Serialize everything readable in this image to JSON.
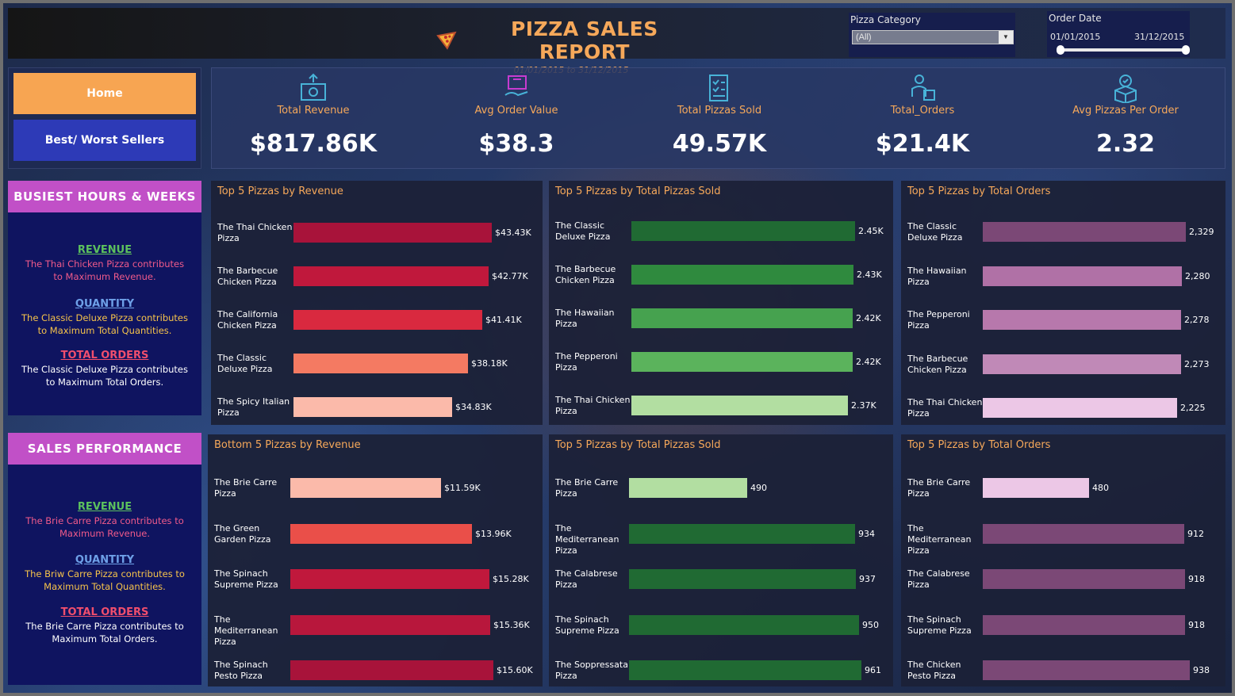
{
  "header": {
    "title": "PIZZA SALES REPORT",
    "subtitle": "01/01/2015  to 31/12/2015",
    "category_filter": {
      "label": "Pizza Category",
      "value": "(All)"
    },
    "date_filter": {
      "label": "Order Date",
      "start": "01/01/2015",
      "end": "31/12/2015"
    }
  },
  "nav": {
    "home": "Home",
    "sellers": "Best/ Worst Sellers"
  },
  "kpis": [
    {
      "label": "Total Revenue",
      "value": "$817.86K",
      "icon": "money-icon"
    },
    {
      "label": "Avg Order Value",
      "value": "$38.3",
      "icon": "delivery-box-icon"
    },
    {
      "label": "Total Pizzas Sold",
      "value": "49.57K",
      "icon": "checklist-icon"
    },
    {
      "label": "Total_Orders",
      "value": "$21.4K",
      "icon": "delivery-person-icon"
    },
    {
      "label": "Avg Pizzas Per Order",
      "value": "2.32",
      "icon": "badge-box-icon"
    }
  ],
  "busiest": {
    "title": "BUSIEST HOURS & WEEKS",
    "revenue_h": "REVENUE",
    "revenue_t": "The Thai Chicken Pizza contributes to Maximum Revenue.",
    "quantity_h": "QUANTITY",
    "quantity_t": "The Classic Deluxe Pizza contributes to Maximum Total Quantities.",
    "orders_h": "TOTAL ORDERS",
    "orders_t": "The Classic Deluxe Pizza contributes to Maximum Total Orders."
  },
  "performance": {
    "title": "SALES PERFORMANCE",
    "revenue_h": "REVENUE",
    "revenue_t": "The Brie Carre Pizza contributes to Maximum Revenue.",
    "quantity_h": "QUANTITY",
    "quantity_t": "The Briw Carre Pizza contributes to Maximum Total Quantities.",
    "orders_h": "TOTAL ORDERS",
    "orders_t": "The Brie Carre Pizza contributes to Maximum Total Orders."
  },
  "colors": {
    "accent": "#f6a85a",
    "home_btn": "#f7a552",
    "sellers_btn": "#2d3ab7",
    "panel_head": "#c150c7"
  },
  "chart_data": [
    {
      "type": "bar",
      "orientation": "horizontal",
      "title": "Top 5 Pizzas by Revenue",
      "categories": [
        "The Thai Chicken Pizza",
        "The Barbecue Chicken Pizza",
        "The California Chicken Pizza",
        "The Classic Deluxe Pizza",
        "The Spicy Italian Pizza"
      ],
      "values": [
        43430,
        42770,
        41410,
        38180,
        34830
      ],
      "labels": [
        "$43.43K",
        "$42.77K",
        "$41.41K",
        "$38.18K",
        "$34.83K"
      ],
      "colors": [
        "#a8133a",
        "#c0183c",
        "#d9293f",
        "#f47a62",
        "#fbbaaa"
      ]
    },
    {
      "type": "bar",
      "orientation": "horizontal",
      "title": "Top 5 Pizzas by Total Pizzas Sold",
      "categories": [
        "The Classic Deluxe Pizza",
        "The Barbecue Chicken Pizza",
        "The Hawaiian Pizza",
        "The Pepperoni Pizza",
        "The Thai Chicken Pizza"
      ],
      "values": [
        2450,
        2430,
        2420,
        2420,
        2370
      ],
      "labels": [
        "2.45K",
        "2.43K",
        "2.42K",
        "2.42K",
        "2.37K"
      ],
      "colors": [
        "#206a33",
        "#2f8a3e",
        "#46a24f",
        "#5bb35c",
        "#b2dea1"
      ]
    },
    {
      "type": "bar",
      "orientation": "horizontal",
      "title": "Top 5 Pizzas by Total Orders",
      "categories": [
        "The Classic Deluxe Pizza",
        "The Hawaiian Pizza",
        "The Pepperoni Pizza",
        "The Barbecue Chicken Pizza",
        "The Thai Chicken Pizza"
      ],
      "values": [
        2329,
        2280,
        2278,
        2273,
        2225
      ],
      "labels": [
        "2,329",
        "2,280",
        "2,278",
        "2,273",
        "2,225"
      ],
      "colors": [
        "#7b4876",
        "#b071a6",
        "#b778ac",
        "#c089b7",
        "#ecc7e6"
      ]
    },
    {
      "type": "bar",
      "orientation": "horizontal",
      "title": "Bottom 5 Pizzas by Revenue",
      "categories": [
        "The Brie Carre Pizza",
        "The Green Garden Pizza",
        "The Spinach Supreme Pizza",
        "The Mediterranean Pizza",
        "The Spinach Pesto Pizza"
      ],
      "values": [
        11590,
        13960,
        15280,
        15360,
        15600
      ],
      "labels": [
        "$11.59K",
        "$13.96K",
        "$15.28K",
        "$15.36K",
        "$15.60K"
      ],
      "colors": [
        "#fbbaaa",
        "#ea4f49",
        "#c0183c",
        "#b8173c",
        "#a8133a"
      ]
    },
    {
      "type": "bar",
      "orientation": "horizontal",
      "title": "Top 5 Pizzas by Total Pizzas Sold",
      "categories": [
        "The Brie Carre Pizza",
        "The Mediterranean Pizza",
        "The Calabrese Pizza",
        "The Spinach Supreme Pizza",
        "The Soppressata Pizza"
      ],
      "values": [
        490,
        934,
        937,
        950,
        961
      ],
      "labels": [
        "490",
        "934",
        "937",
        "950",
        "961"
      ],
      "colors": [
        "#b2dea1",
        "#206a33",
        "#206a33",
        "#206a33",
        "#206a33"
      ]
    },
    {
      "type": "bar",
      "orientation": "horizontal",
      "title": "Top 5 Pizzas by Total Orders",
      "categories": [
        "The Brie Carre Pizza",
        "The Mediterranean Pizza",
        "The Calabrese Pizza",
        "The Spinach Supreme Pizza",
        "The Chicken Pesto Pizza"
      ],
      "values": [
        480,
        912,
        918,
        918,
        938
      ],
      "labels": [
        "480",
        "912",
        "918",
        "918",
        "938"
      ],
      "colors": [
        "#ecc7e6",
        "#7b4876",
        "#7b4876",
        "#7b4876",
        "#7b4876"
      ]
    }
  ]
}
